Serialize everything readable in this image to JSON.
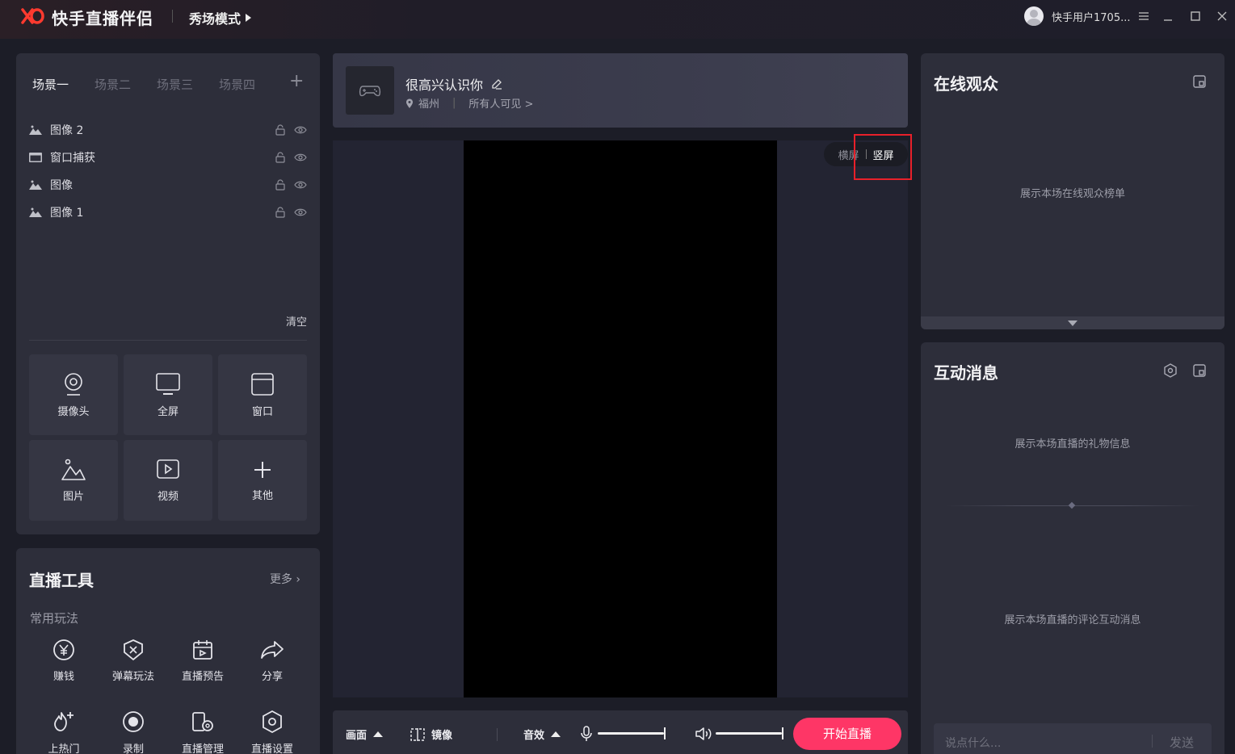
{
  "app": {
    "title": "快手直播伴侣",
    "mode": "秀场模式",
    "username": "快手用户1705...",
    "accent_color": "#fe3666",
    "logo_color": "#fe3a2f"
  },
  "window_controls": [
    "menu-icon",
    "minimize-icon",
    "maximize-icon",
    "close-icon"
  ],
  "scenes": {
    "tabs": [
      "场景一",
      "场景二",
      "场景三",
      "场景四"
    ],
    "active": "场景一",
    "sources": [
      {
        "label": "图像 2",
        "icon": "image-icon"
      },
      {
        "label": "窗口捕获",
        "icon": "window-capture-icon"
      },
      {
        "label": "图像",
        "icon": "image-icon"
      },
      {
        "label": "图像 1",
        "icon": "image-icon"
      }
    ],
    "clear_label": "清空",
    "add_sources": [
      {
        "label": "摄像头",
        "icon": "camera-icon"
      },
      {
        "label": "全屏",
        "icon": "monitor-icon"
      },
      {
        "label": "窗口",
        "icon": "window-icon"
      },
      {
        "label": "图片",
        "icon": "picture-icon"
      },
      {
        "label": "视频",
        "icon": "video-icon"
      },
      {
        "label": "其他",
        "icon": "plus-icon"
      }
    ]
  },
  "tools": {
    "title": "直播工具",
    "more_label": "更多",
    "section_label": "常用玩法",
    "items": [
      {
        "label": "赚钱",
        "icon": "yen-icon"
      },
      {
        "label": "弹幕玩法",
        "icon": "danmaku-icon"
      },
      {
        "label": "直播预告",
        "icon": "calendar-icon"
      },
      {
        "label": "分享",
        "icon": "share-icon"
      },
      {
        "label": "上热门",
        "icon": "fire-icon"
      },
      {
        "label": "录制",
        "icon": "record-icon"
      },
      {
        "label": "直播管理",
        "icon": "manage-icon"
      },
      {
        "label": "直播设置",
        "icon": "settings-icon"
      }
    ]
  },
  "stream": {
    "title": "很高兴认识你",
    "location": "福州",
    "visibility": "所有人可见 >"
  },
  "preview": {
    "orientation_landscape": "横屏",
    "orientation_portrait": "竖屏",
    "active_orientation": "竖屏"
  },
  "bottom_bar": {
    "scene_label": "画面",
    "mirror_label": "镜像",
    "effects_label": "音效",
    "start_label": "开始直播"
  },
  "audience": {
    "title": "在线观众",
    "empty_tip": "展示本场在线观众榜单"
  },
  "messages": {
    "title": "互动消息",
    "gift_tip": "展示本场直播的礼物信息",
    "comment_tip": "展示本场直播的评论互动消息",
    "input_placeholder": "说点什么...",
    "send_label": "发送"
  }
}
